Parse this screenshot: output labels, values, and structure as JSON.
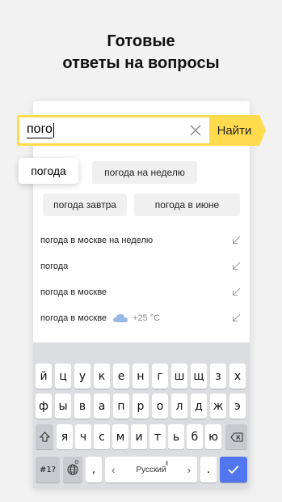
{
  "headline": {
    "line1": "Готовые",
    "line2": "ответы на вопросы"
  },
  "search": {
    "query": "пого",
    "button_label": "Найти"
  },
  "chips": {
    "main": "погода",
    "items": [
      "погода на неделю",
      "погода завтра",
      "погода в июне"
    ]
  },
  "suggestions": [
    {
      "text": "погода в москве на неделю"
    },
    {
      "text": "погода"
    },
    {
      "text": "погода в москве"
    },
    {
      "text": "погода в москве",
      "weather": "+25 °C"
    }
  ],
  "keyboard": {
    "row1": [
      "й",
      "ц",
      "у",
      "к",
      "е",
      "н",
      "г",
      "ш",
      "щ",
      "з",
      "х"
    ],
    "row2": [
      "ф",
      "ы",
      "в",
      "а",
      "п",
      "р",
      "о",
      "л",
      "д",
      "ж",
      "э"
    ],
    "row3": [
      "я",
      "ч",
      "с",
      "м",
      "и",
      "т",
      "ь",
      "б",
      "ю"
    ],
    "symbols_label": "#1?",
    "comma": ",",
    "left_arrow": "‹",
    "space_label": "Русский",
    "right_arrow": "›",
    "period": "."
  },
  "colors": {
    "accent": "#ffdb4d",
    "enter": "#5275f0",
    "keyboard_bg": "#dcdde0"
  }
}
